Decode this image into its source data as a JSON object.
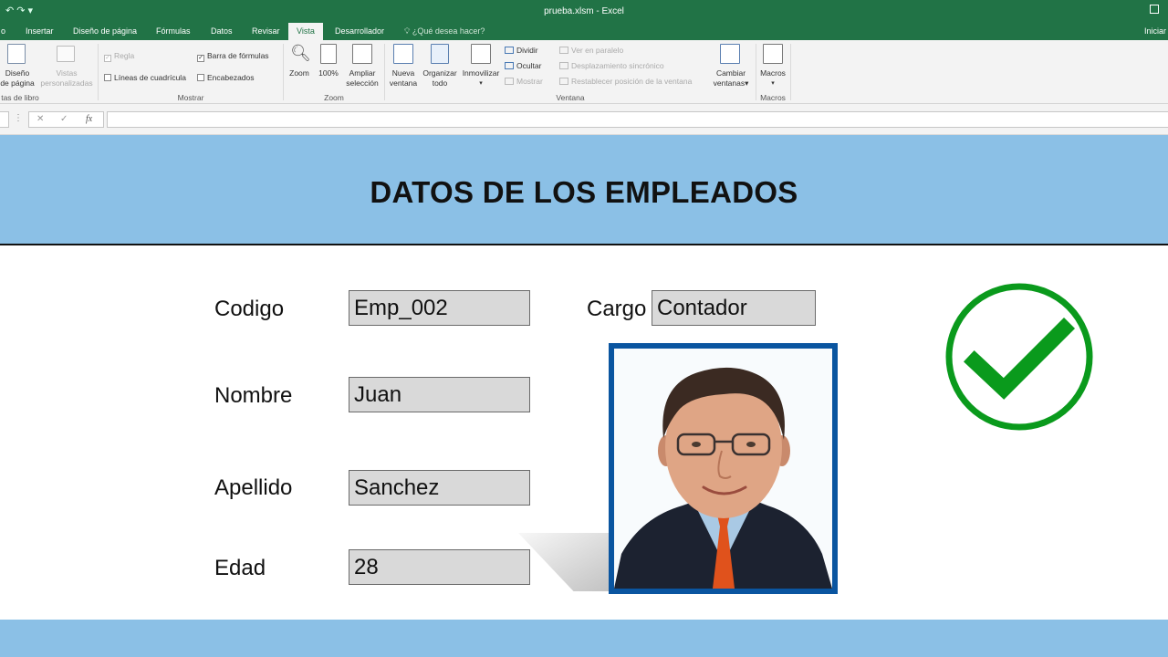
{
  "window": {
    "title": "prueba.xlsm - Excel"
  },
  "quick_access": {
    "symbols": "↶ ↷  ▾"
  },
  "tabs": [
    {
      "label": "o"
    },
    {
      "label": "Insertar"
    },
    {
      "label": "Diseño de página"
    },
    {
      "label": "Fórmulas"
    },
    {
      "label": "Datos"
    },
    {
      "label": "Revisar"
    },
    {
      "label": "Vista"
    },
    {
      "label": "Desarrollador"
    }
  ],
  "tell_me": "¿Qué desea hacer?",
  "signin": "Iniciar",
  "ribbon": {
    "views": {
      "page_layout": [
        "Diseño",
        "de página"
      ],
      "custom_views": [
        "Vistas",
        "personalizadas"
      ],
      "group_label": "tas de libro"
    },
    "show": {
      "ruler": "Regla",
      "gridlines": "Líneas de cuadrícula",
      "formula_bar": "Barra de fórmulas",
      "headings": "Encabezados",
      "group_label": "Mostrar"
    },
    "zoom": {
      "zoom": "Zoom",
      "zoom100": "100%",
      "zoom_selection": [
        "Ampliar",
        "selección"
      ],
      "group_label": "Zoom"
    },
    "window": {
      "new_window": [
        "Nueva",
        "ventana"
      ],
      "arrange_all": [
        "Organizar",
        "todo"
      ],
      "freeze": "Inmovilizar",
      "split": "Dividir",
      "hide": "Ocultar",
      "show": "Mostrar",
      "side_by_side": "Ver en paralelo",
      "sync_scroll": "Desplazamiento sincrónico",
      "reset_position": "Restablecer posición de la ventana",
      "switch_windows": [
        "Cambiar",
        "ventanas"
      ],
      "group_label": "Ventana"
    },
    "macros": {
      "label": "Macros",
      "group_label": "Macros"
    }
  },
  "formula_bar": {
    "fx": "fx",
    "cancel": "✕",
    "enter": "✓",
    "value": ""
  },
  "sheet": {
    "title": "DATOS DE LOS EMPLEADOS",
    "fields": [
      {
        "label": "Codigo",
        "value": "Emp_002"
      },
      {
        "label": "Nombre",
        "value": "Juan"
      },
      {
        "label": "Apellido",
        "value": "Sanchez"
      },
      {
        "label": "Edad",
        "value": "28"
      },
      {
        "label": "Cargo",
        "value": "Contador"
      }
    ]
  },
  "colors": {
    "excel_green": "#217346",
    "banner_blue": "#8bc0e6",
    "photo_border": "#0a55a0",
    "check_green": "#0a9a1c"
  }
}
